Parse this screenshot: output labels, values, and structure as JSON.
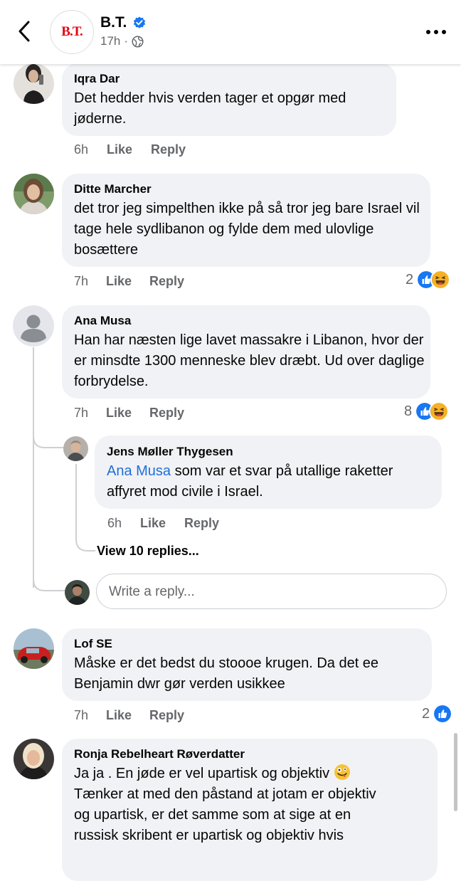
{
  "header": {
    "page_name": "B.T.",
    "logo_text": "B.T.",
    "time": "17h",
    "separator": "·",
    "brand_color": "#e30613",
    "accent_color": "#1877f2"
  },
  "comments": [
    {
      "author": "Iqra Dar",
      "text": "Det hedder hvis verden tager et opgør med jøderne.",
      "time": "6h",
      "like": "Like",
      "reply": "Reply"
    },
    {
      "author": "Ditte Marcher",
      "text": " det tror jeg simpelthen ikke på så tror jeg bare Israel vil tage hele sydlibanon og fylde dem med ulovlige bosættere",
      "time": "7h",
      "like": "Like",
      "reply": "Reply",
      "reaction_count": "2",
      "reactions": [
        "like-icon",
        "haha-icon"
      ]
    },
    {
      "author": "Ana Musa",
      "text": "Han har næsten  lige lavet massakre i Libanon, hvor der er minsdte 1300 menneske blev dræbt. Ud over daglige forbrydelse.",
      "time": "7h",
      "like": "Like",
      "reply": "Reply",
      "reaction_count": "8",
      "reactions": [
        "like-icon",
        "haha-icon"
      ],
      "replies": [
        {
          "author": "Jens Møller Thygesen",
          "mention": "Ana Musa",
          "text": " som var et svar på utallige raketter affyret mod civile i Israel.",
          "time": "6h",
          "like": "Like",
          "reply": "Reply"
        }
      ],
      "view_more": "View 10 replies...",
      "reply_placeholder": "Write a reply..."
    },
    {
      "author": "Lof SE",
      "text": "Måske er det bedst du stoooe krugen. Da det ee Benjamin dwr gør verden usikkee",
      "time": "7h",
      "like": "Like",
      "reply": "Reply",
      "reaction_count": "2",
      "reactions": [
        "like-icon"
      ]
    },
    {
      "author": "Ronja Rebelheart Røverdatter",
      "text_lines": [
        "Ja ja . En jøde er vel upartisk og objektiv",
        "Tænker at med den påstand at jotam er objektiv",
        "og upartisk, er det samme som at sige at en",
        "russisk skribent er upartisk og objektiv hvis"
      ],
      "emoji": "zany-face-icon"
    }
  ]
}
